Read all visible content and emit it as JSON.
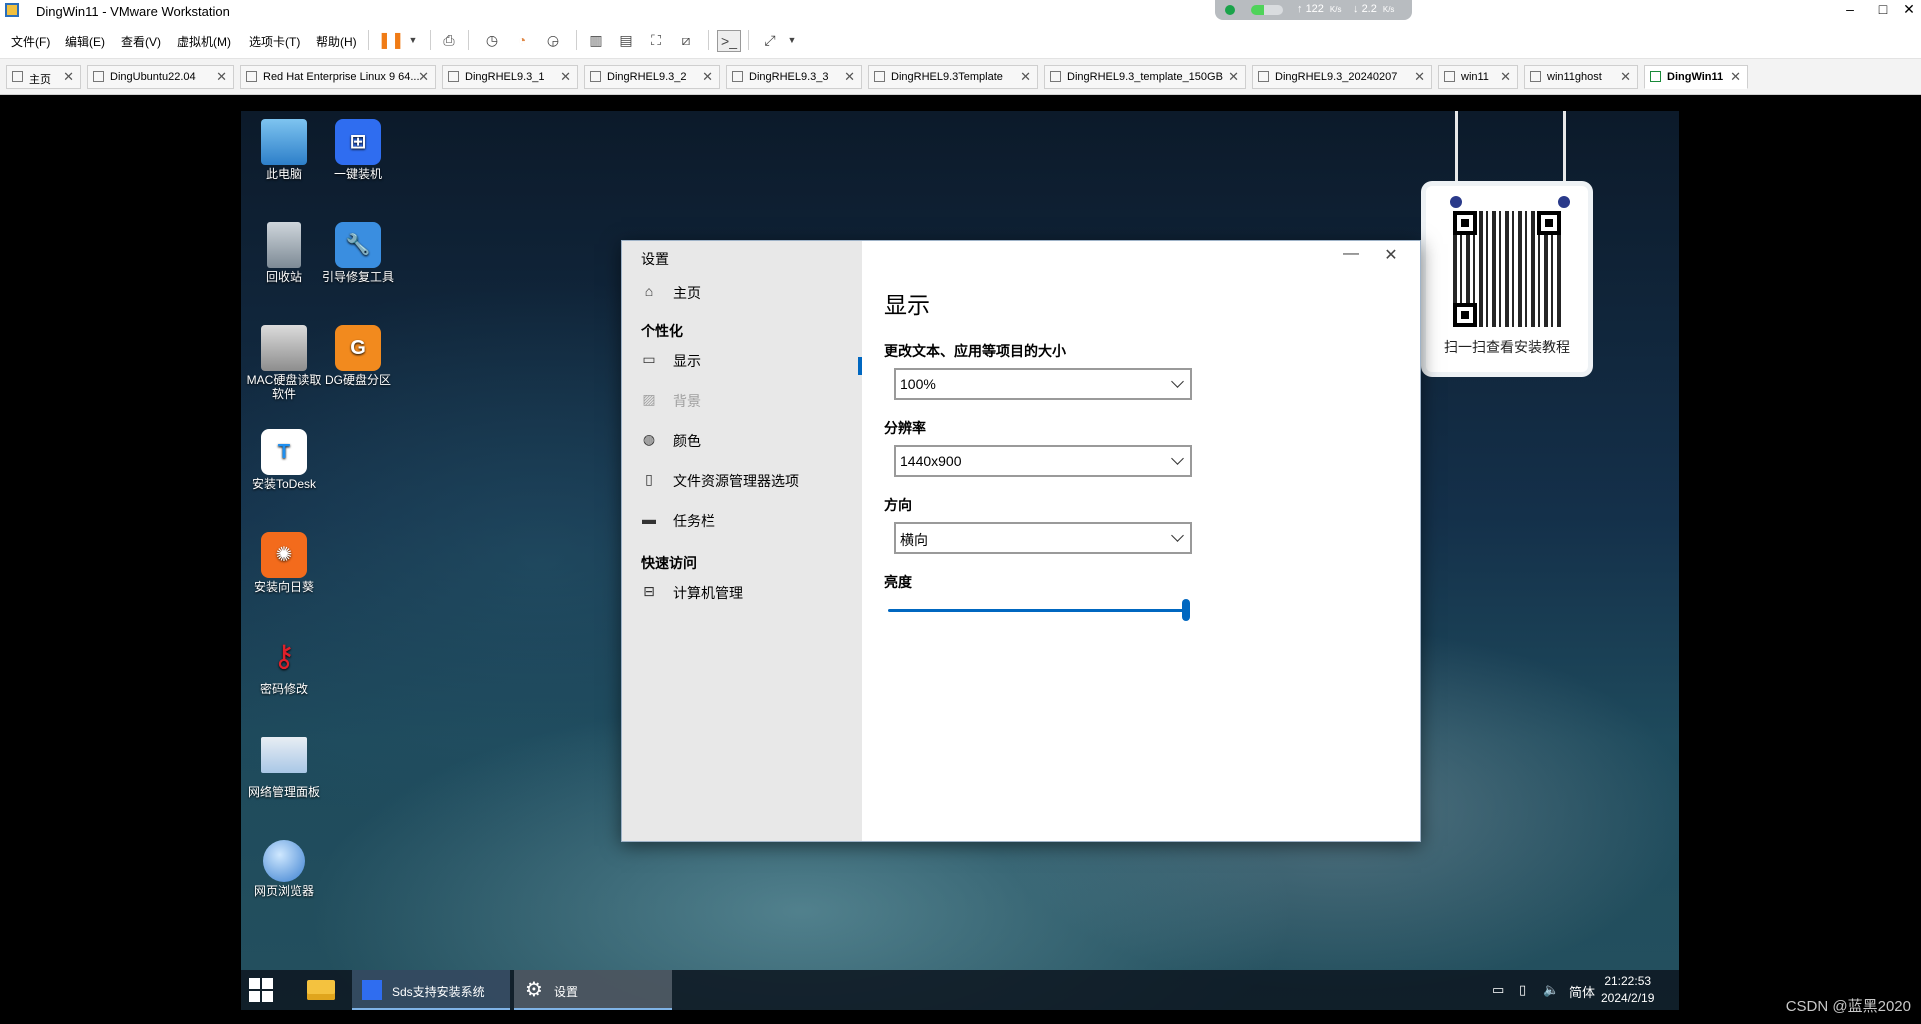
{
  "window": {
    "title": "DingWin11 - VMware Workstation",
    "net_up": "122",
    "net_down": "2.2",
    "net_unit": "K/s",
    "minimize": "–",
    "maximize": "□",
    "close": "✕"
  },
  "menu": [
    "文件(F)",
    "编辑(E)",
    "查看(V)",
    "虚拟机(M)",
    "选项卡(T)",
    "帮助(H)"
  ],
  "tabs": [
    {
      "label": "主页"
    },
    {
      "label": "DingUbuntu22.04"
    },
    {
      "label": "Red Hat Enterprise Linux 9 64..."
    },
    {
      "label": "DingRHEL9.3_1"
    },
    {
      "label": "DingRHEL9.3_2"
    },
    {
      "label": "DingRHEL9.3_3"
    },
    {
      "label": "DingRHEL9.3Template"
    },
    {
      "label": "DingRHEL9.3_template_150GB"
    },
    {
      "label": "DingRHEL9.3_20240207"
    },
    {
      "label": "win11"
    },
    {
      "label": "win11ghost"
    },
    {
      "label": "DingWin11"
    }
  ],
  "desktop": {
    "icons": [
      {
        "label": "此电脑"
      },
      {
        "label": "一键装机"
      },
      {
        "label": "回收站"
      },
      {
        "label": "引导修复工具"
      },
      {
        "label": "MAC硬盘读取软件"
      },
      {
        "label": "DG硬盘分区"
      },
      {
        "label": "安装ToDesk"
      },
      {
        "label": "安装向日葵"
      },
      {
        "label": "密码修改"
      },
      {
        "label": "网络管理面板"
      },
      {
        "label": "网页浏览器"
      }
    ],
    "qr_caption": "扫一扫查看安装教程"
  },
  "settings": {
    "window_title": "设置",
    "home": "主页",
    "section_personalize": "个性化",
    "nav": [
      {
        "label": "显示",
        "icon": "monitor-icon"
      },
      {
        "label": "背景",
        "icon": "image-icon"
      },
      {
        "label": "颜色",
        "icon": "palette-icon"
      },
      {
        "label": "文件资源管理器选项",
        "icon": "folder-options-icon"
      },
      {
        "label": "任务栏",
        "icon": "taskbar-icon"
      }
    ],
    "section_quick": "快速访问",
    "quick_item": "计算机管理",
    "page_title": "显示",
    "scale_label": "更改文本、应用等项目的大小",
    "scale_value": "100%",
    "resolution_label": "分辨率",
    "resolution_value": "1440x900",
    "orientation_label": "方向",
    "orientation_value": "横向",
    "brightness_label": "亮度",
    "brightness_level": 1.0
  },
  "taskbar": {
    "apps": [
      {
        "label": "Sds支持安装系统"
      },
      {
        "label": "设置"
      }
    ],
    "ime": "简体",
    "time": "21:22:53",
    "date": "2024/2/19"
  },
  "watermark": "CSDN @蓝黑2020",
  "colors": {
    "accent": "#0067c0",
    "pause": "#f07b15"
  }
}
